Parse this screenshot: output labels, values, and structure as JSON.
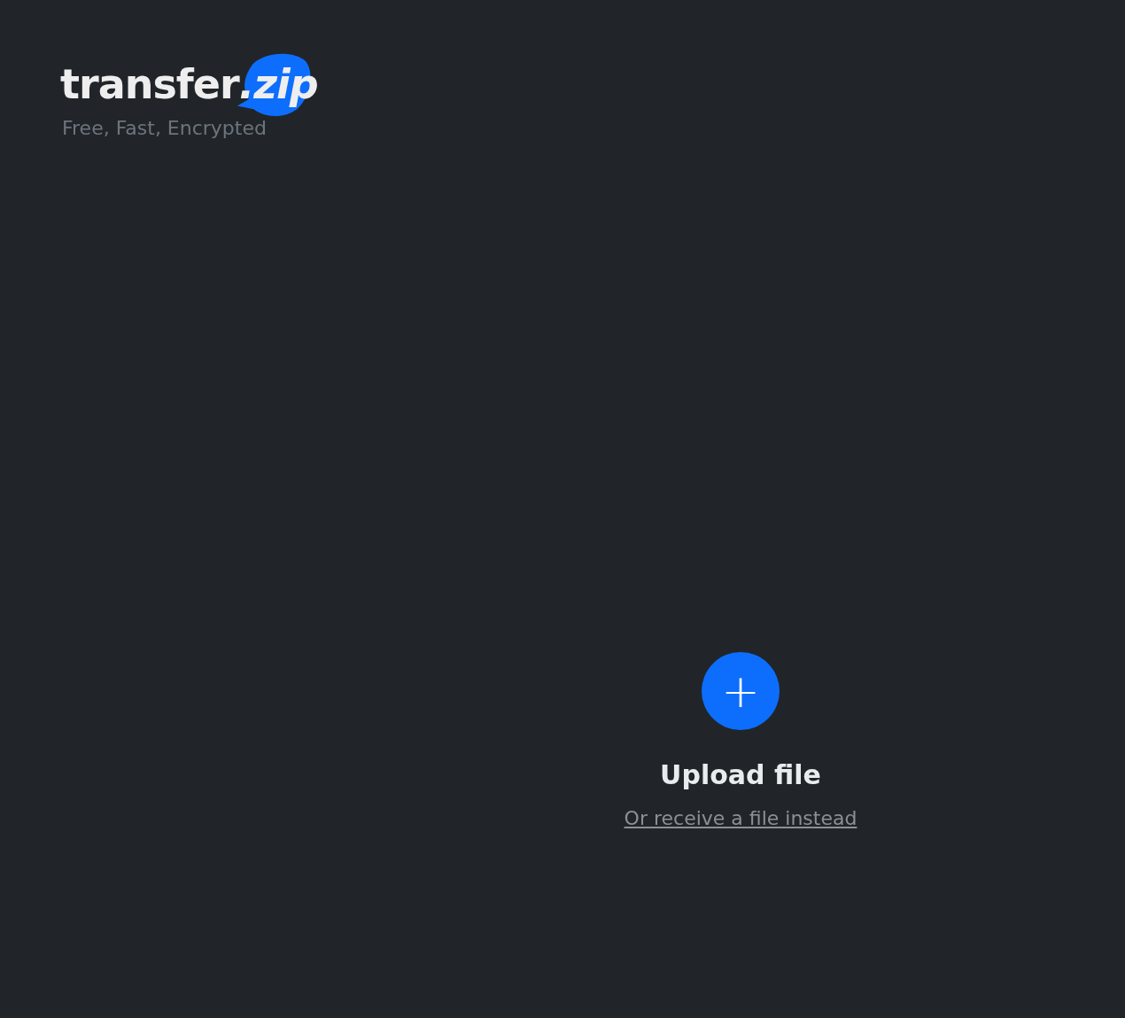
{
  "logo": {
    "name": "transfer",
    "suffix": ".zip",
    "tagline": "Free, Fast, Encrypted"
  },
  "upload": {
    "icon": "+",
    "title": "Upload file",
    "link": "Or receive a file instead"
  }
}
